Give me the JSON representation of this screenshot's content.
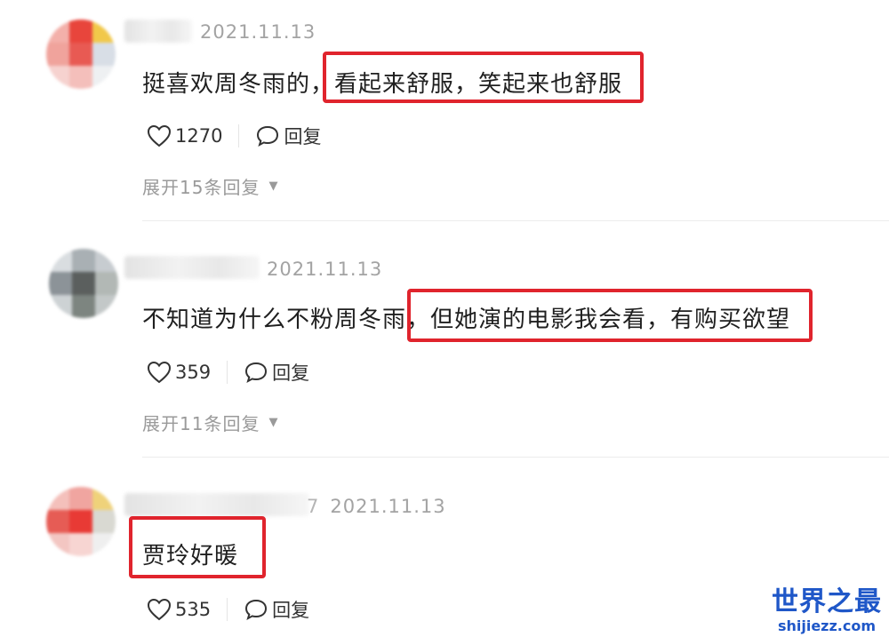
{
  "comments": [
    {
      "date": "2021.11.13",
      "text_plain": "挺喜欢周冬雨的，",
      "text_highlight": "看起来舒服，笑起来也舒服",
      "likes": "1270",
      "reply_label": "回复",
      "expand_label": "展开15条回复"
    },
    {
      "date": "2021.11.13",
      "text_plain": "不知道为什么不粉周冬雨，",
      "text_highlight": "但她演的电影我会看，有购买欲望",
      "likes": "359",
      "reply_label": "回复",
      "expand_label": "展开11条回复"
    },
    {
      "date": "2021.11.13",
      "name_tail": "7",
      "text_plain": "",
      "text_highlight": "贾玲好暖",
      "likes": "535",
      "reply_label": "回复"
    }
  ],
  "watermark": {
    "cn": "世界之最",
    "en": "shijiezz.com"
  },
  "colors": {
    "highlight_border": "#e0242d",
    "date_text": "#a3a3a3",
    "watermark": "#1f57c8"
  },
  "icons": [
    "heart-icon",
    "speech-bubble-icon",
    "chevron-down-icon"
  ]
}
